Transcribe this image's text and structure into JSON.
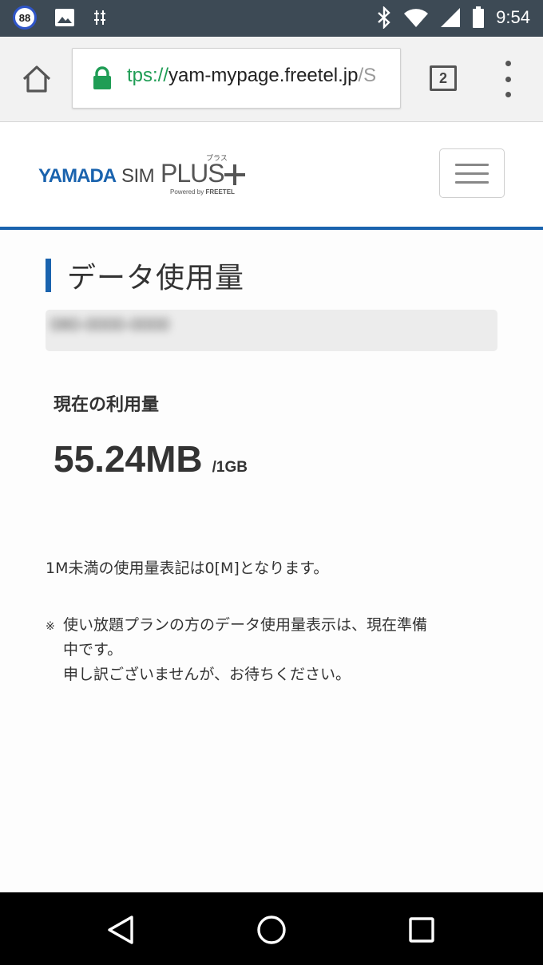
{
  "status_bar": {
    "notification_badge": "88",
    "time": "9:54",
    "icons": [
      "photo-icon",
      "usb-debug-icon",
      "bluetooth-icon",
      "wifi-icon",
      "signal-icon",
      "battery-icon"
    ]
  },
  "browser": {
    "url_scheme": "tps://",
    "url_host": "yam-mypage.freetel.jp",
    "url_rest": "/S",
    "tab_count": "2"
  },
  "site": {
    "logo_text": "YAMADA SIM PLUS+",
    "logo_sub": "Powered by FREETEL",
    "logo_ruby": "プラス"
  },
  "main": {
    "page_title": "データ使用量",
    "phone_number_blurred": "080-0000-0000",
    "current_usage_label": "現在の利用量",
    "usage_value": "55.24MB",
    "usage_total": "/1GB",
    "note_1": "1M未満の使用量表記は0[M]となります。",
    "note_2_mark": "※",
    "note_2_line1": "使い放題プランの方のデータ使用量表示は、現在準備",
    "note_2_line2": "中です。",
    "note_2_line3": "申し訳ございませんが、お待ちください。"
  },
  "colors": {
    "status_bar": "#3d4a55",
    "accent_blue": "#1a63ae",
    "secure_green": "#1f9d55"
  }
}
